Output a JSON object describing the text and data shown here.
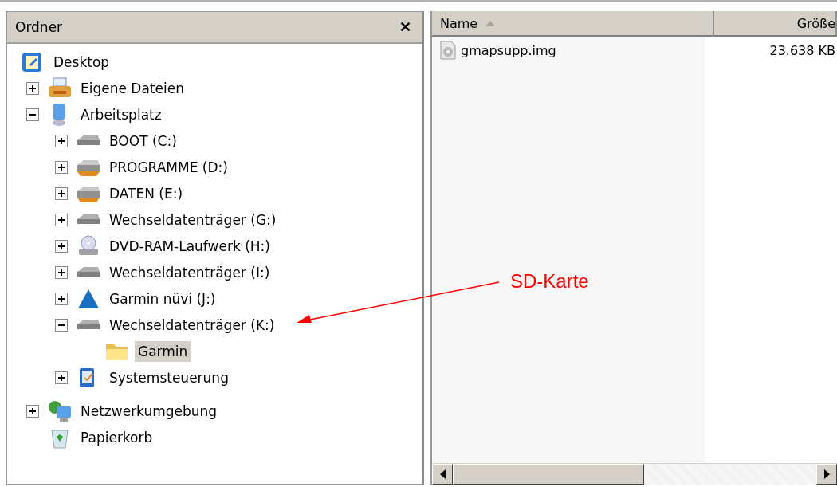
{
  "folder_pane": {
    "title": "Ordner",
    "close": "✕",
    "tree": [
      {
        "label": "Desktop",
        "kind": "desktop",
        "selected": false,
        "children": [
          {
            "label": "Eigene Dateien",
            "kind": "documents",
            "expanded": false,
            "selected": false
          },
          {
            "label": "Arbeitsplatz",
            "kind": "computer",
            "expanded": true,
            "selected": false,
            "children": [
              {
                "label": "BOOT (C:)",
                "kind": "drive",
                "expanded": false,
                "selected": false
              },
              {
                "label": "PROGRAMME (D:)",
                "kind": "shared-drive",
                "expanded": false,
                "selected": false
              },
              {
                "label": "DATEN (E:)",
                "kind": "shared-drive",
                "expanded": false,
                "selected": false
              },
              {
                "label": "Wechseldatenträger (G:)",
                "kind": "drive",
                "expanded": false,
                "selected": false
              },
              {
                "label": "DVD-RAM-Laufwerk (H:)",
                "kind": "dvd",
                "expanded": false,
                "selected": false
              },
              {
                "label": "Wechseldatenträger (I:)",
                "kind": "drive",
                "expanded": false,
                "selected": false
              },
              {
                "label": "Garmin nüvi (J:)",
                "kind": "triangle",
                "expanded": false,
                "selected": false
              },
              {
                "label": "Wechseldatenträger (K:)",
                "kind": "drive",
                "expanded": true,
                "selected": false,
                "children": [
                  {
                    "label": "Garmin",
                    "kind": "folder",
                    "selected": true
                  }
                ]
              },
              {
                "label": "Systemsteuerung",
                "kind": "control-panel",
                "expanded": false,
                "selected": false
              }
            ]
          },
          {
            "label": "Netzwerkumgebung",
            "kind": "network",
            "expanded": false,
            "selected": false
          },
          {
            "label": "Papierkorb",
            "kind": "recycle",
            "selected": false
          }
        ]
      }
    ]
  },
  "file_list": {
    "columns": [
      "Name",
      "Größe"
    ],
    "rows": [
      {
        "name": "gmapsupp.img",
        "size": "23.638 KB"
      }
    ]
  },
  "annotation": {
    "label": "SD-Karte"
  }
}
